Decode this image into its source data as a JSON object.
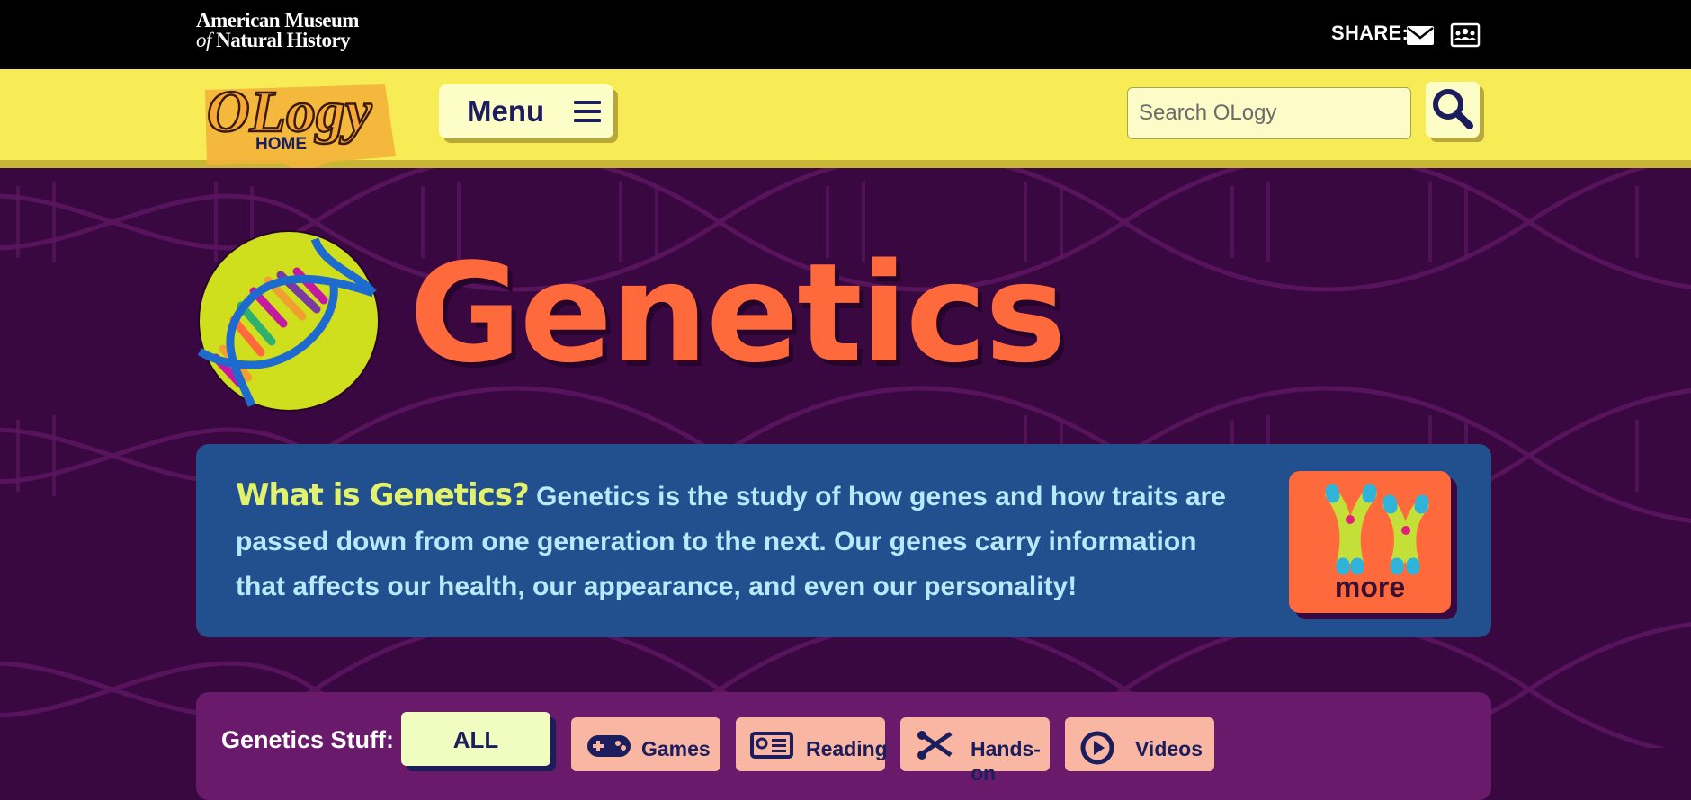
{
  "header": {
    "museum_line1": "American Museum",
    "museum_of": "of",
    "museum_line2": "Natural History",
    "share_label": "SHARE:"
  },
  "nav": {
    "logo_text": "OLogy",
    "logo_home": "HOME",
    "menu_label": "Menu",
    "search_placeholder": "Search OLogy"
  },
  "hero": {
    "title": "Genetics"
  },
  "intro": {
    "question": "What is Genetics?",
    "body": " Genetics is the study of how genes and how traits are passed down from one generation to the next. Our genes carry information that affects our health, our appearance, and even our personality!",
    "more_label": "more"
  },
  "stuff": {
    "label": "Genetics Stuff:",
    "filters": [
      {
        "label": "ALL",
        "icon": "none"
      },
      {
        "label": "Games",
        "icon": "gamepad-icon"
      },
      {
        "label": "Reading",
        "icon": "newspaper-icon"
      },
      {
        "label": "Hands-on",
        "icon": "scissors-icon"
      },
      {
        "label": "Videos",
        "icon": "play-icon"
      }
    ]
  },
  "colors": {
    "top_bar": "#000000",
    "nav_bar": "#f7ec55",
    "hero_background": "#3a0840",
    "title": "#ff6a3d",
    "info_panel": "#22508e",
    "info_question": "#e2f26c",
    "info_text": "#b8eaff",
    "more_card": "#ff6a3d",
    "stuff_panel": "#6a1a6a"
  }
}
